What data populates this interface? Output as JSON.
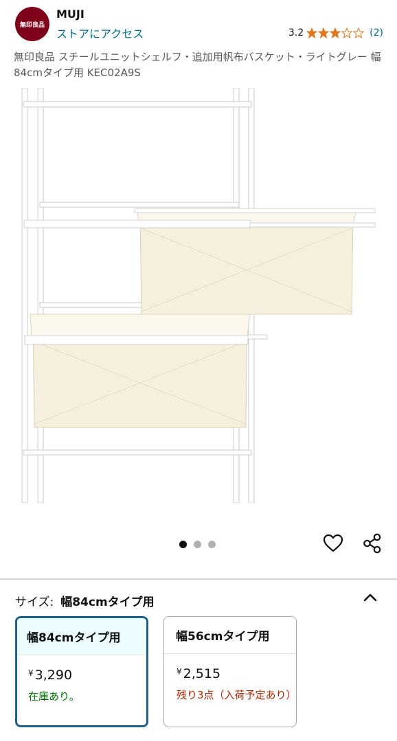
{
  "header": {
    "logo_text": "無印良品",
    "brand": "MUJI",
    "store_link": "ストアにアクセス",
    "rating_value": "3.2",
    "rating_stars": 3.2,
    "rating_count": "(2)",
    "star_color": "#de7921"
  },
  "product": {
    "title": "無印良品 スチールユニットシェルフ・追加用帆布バスケット・ライトグレー 幅84cmタイプ用 KEC02A9S",
    "image_count": 3,
    "image_active_index": 0
  },
  "icons": {
    "favorite": "heart-icon",
    "share": "share-icon",
    "collapse": "chevron-up-icon"
  },
  "size_selector": {
    "label": "サイズ:",
    "selected_value": "幅84cmタイプ用",
    "options": [
      {
        "name": "幅84cmタイプ用",
        "currency": "¥",
        "price": "3,290",
        "availability": "在庫あり。",
        "selected": true
      },
      {
        "name": "幅56cmタイプ用",
        "currency": "¥",
        "price": "2,515",
        "availability": "残り3点（入荷予定あり）",
        "selected": false
      }
    ]
  },
  "colors": {
    "link": "#007185",
    "in_stock": "#007600",
    "low_stock": "#b12704",
    "selected_border": "#1f5f8b",
    "logo_bg": "#7f0019"
  }
}
